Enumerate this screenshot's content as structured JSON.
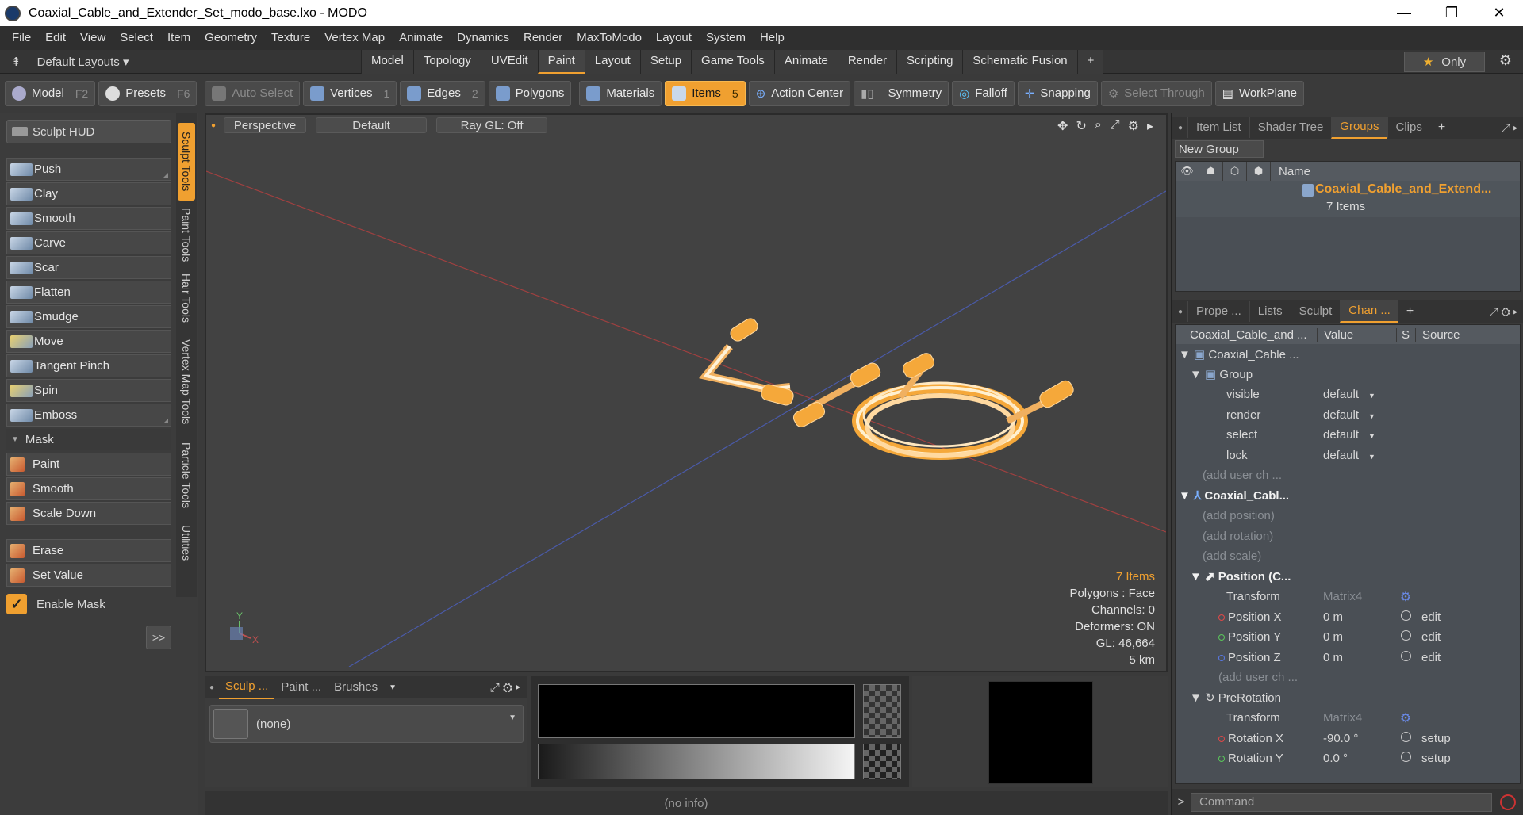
{
  "window": {
    "title": "Coaxial_Cable_and_Extender_Set_modo_base.lxo - MODO",
    "minimize": "—",
    "maximize": "❐",
    "close": "✕"
  },
  "menu": [
    "File",
    "Edit",
    "View",
    "Select",
    "Item",
    "Geometry",
    "Texture",
    "Vertex Map",
    "Animate",
    "Dynamics",
    "Render",
    "MaxToModo",
    "Layout",
    "System",
    "Help"
  ],
  "layouts": {
    "label": "Default Layouts ▾"
  },
  "mode_tabs": [
    "Model",
    "Topology",
    "UVEdit",
    "Paint",
    "Layout",
    "Setup",
    "Game Tools",
    "Animate",
    "Render",
    "Scripting",
    "Schematic Fusion"
  ],
  "active_mode_tab": "Paint",
  "only_btn": "Only",
  "toolbar": {
    "model": "Model",
    "model_key": "F2",
    "presets": "Presets",
    "presets_key": "F6",
    "auto_select": "Auto Select",
    "vertices": "Vertices",
    "vertices_key": "1",
    "edges": "Edges",
    "edges_key": "2",
    "polygons": "Polygons",
    "materials": "Materials",
    "items": "Items",
    "items_key": "5",
    "action_center": "Action Center",
    "symmetry": "Symmetry",
    "falloff": "Falloff",
    "snapping": "Snapping",
    "select_through": "Select Through",
    "workplane": "WorkPlane"
  },
  "sculpt": {
    "hud": "Sculpt HUD",
    "tools": [
      "Push",
      "Clay",
      "Smooth",
      "Carve",
      "Scar",
      "Flatten",
      "Smudge",
      "Move",
      "Tangent Pinch",
      "Spin",
      "Emboss"
    ],
    "mask_label": "Mask",
    "mask_tools": [
      "Paint",
      "Smooth",
      "Scale Down"
    ],
    "value_tools": [
      "Erase",
      "Set Value"
    ],
    "enable_mask": "Enable Mask",
    "more": ">>"
  },
  "vtabs": [
    "Sculpt Tools",
    "Paint Tools",
    "Hair Tools",
    "Vertex Map Tools",
    "Particle Tools",
    "Utilities"
  ],
  "viewport": {
    "view": "Perspective",
    "shading": "Default",
    "raygl": "Ray GL: Off",
    "info": {
      "items": "7 Items",
      "polygons": "Polygons : Face",
      "channels": "Channels: 0",
      "deformers": "Deformers: ON",
      "gl": "GL: 46,664",
      "scale": "5 km"
    },
    "axis_y": "Y",
    "axis_x": "X"
  },
  "bottom_left": {
    "tabs": [
      "Sculp ...",
      "Paint ...",
      "Brushes"
    ],
    "brush": "(none)"
  },
  "status": "(no info)",
  "right": {
    "top_tabs": [
      "Item List",
      "Shader Tree",
      "Groups",
      "Clips"
    ],
    "new_group": "New Group",
    "name_header": "Name",
    "group_name": "Coaxial_Cable_and_Extend...",
    "group_count": "7 Items",
    "chan_tabs": [
      "Prope ...",
      "Lists",
      "Sculpt",
      "Chan ..."
    ],
    "chan_header": {
      "name": "Coaxial_Cable_and ...",
      "value": "Value",
      "s": "S",
      "source": "Source"
    },
    "rows": [
      {
        "name": "Coaxial_Cable ...",
        "value": "",
        "src": ""
      },
      {
        "name": "Group",
        "value": "",
        "src": ""
      },
      {
        "name": "visible",
        "value": "default",
        "src": ""
      },
      {
        "name": "render",
        "value": "default",
        "src": ""
      },
      {
        "name": "select",
        "value": "default",
        "src": ""
      },
      {
        "name": "lock",
        "value": "default",
        "src": ""
      },
      {
        "name": "(add user ch ...",
        "value": "",
        "src": ""
      },
      {
        "name": "Coaxial_Cabl...",
        "value": "",
        "src": ""
      },
      {
        "name": "(add position)",
        "value": "",
        "src": ""
      },
      {
        "name": "(add rotation)",
        "value": "",
        "src": ""
      },
      {
        "name": "(add scale)",
        "value": "",
        "src": ""
      },
      {
        "name": "Position (C...",
        "value": "",
        "src": ""
      },
      {
        "name": "Transform",
        "value": "Matrix4",
        "src": ""
      },
      {
        "name": "Position X",
        "value": "0 m",
        "src": "edit"
      },
      {
        "name": "Position Y",
        "value": "0 m",
        "src": "edit"
      },
      {
        "name": "Position Z",
        "value": "0 m",
        "src": "edit"
      },
      {
        "name": "(add user ch ...",
        "value": "",
        "src": ""
      },
      {
        "name": "PreRotation",
        "value": "",
        "src": ""
      },
      {
        "name": "Transform",
        "value": "Matrix4",
        "src": ""
      },
      {
        "name": "Rotation X",
        "value": "-90.0 °",
        "src": "setup"
      },
      {
        "name": "Rotation Y",
        "value": "0.0 °",
        "src": "setup"
      }
    ],
    "command_placeholder": "Command"
  },
  "colors": {
    "accent": "#f0a030",
    "mesh": "#f5a83a"
  }
}
